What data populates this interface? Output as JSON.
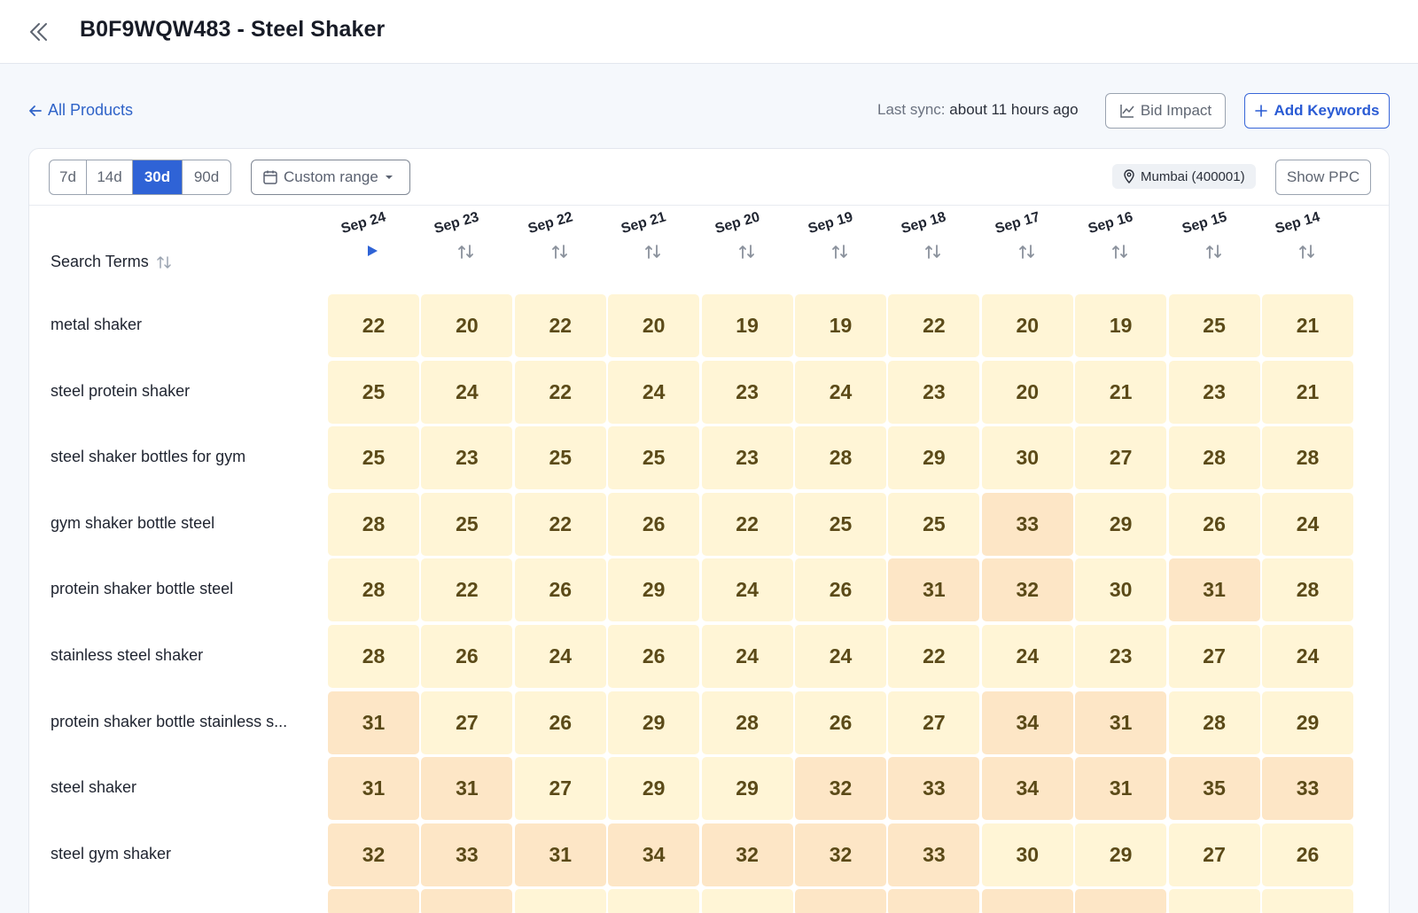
{
  "header": {
    "title": "B0F9WQW483 - Steel Shaker"
  },
  "nav": {
    "all_products": "All Products"
  },
  "sync": {
    "label": "Last sync:",
    "value": "about 11 hours ago"
  },
  "actions": {
    "bid_impact": "Bid Impact",
    "add_keywords": "Add Keywords"
  },
  "ranges": [
    {
      "label": "7d",
      "active": false
    },
    {
      "label": "14d",
      "active": false
    },
    {
      "label": "30d",
      "active": true
    },
    {
      "label": "90d",
      "active": false
    }
  ],
  "custom_range": "Custom range",
  "location": "Mumbai (400001)",
  "show_ppc": "Show PPC",
  "table": {
    "term_header": "Search Terms",
    "dates": [
      "Sep 24",
      "Sep 23",
      "Sep 22",
      "Sep 21",
      "Sep 20",
      "Sep 19",
      "Sep 18",
      "Sep 17",
      "Sep 16",
      "Sep 15",
      "Sep 14"
    ],
    "active_sort_index": 0,
    "rows": [
      {
        "term": "metal shaker",
        "ranks": [
          22,
          20,
          22,
          20,
          19,
          19,
          22,
          20,
          19,
          25,
          21
        ]
      },
      {
        "term": "steel protein shaker",
        "ranks": [
          25,
          24,
          22,
          24,
          23,
          24,
          23,
          20,
          21,
          23,
          21
        ]
      },
      {
        "term": "steel shaker bottles for gym",
        "ranks": [
          25,
          23,
          25,
          25,
          23,
          28,
          29,
          30,
          27,
          28,
          28
        ]
      },
      {
        "term": "gym shaker bottle steel",
        "ranks": [
          28,
          25,
          22,
          26,
          22,
          25,
          25,
          33,
          29,
          26,
          24
        ]
      },
      {
        "term": "protein shaker bottle steel",
        "ranks": [
          28,
          22,
          26,
          29,
          24,
          26,
          31,
          32,
          30,
          31,
          28
        ]
      },
      {
        "term": "stainless steel shaker",
        "ranks": [
          28,
          26,
          24,
          26,
          24,
          24,
          22,
          24,
          23,
          27,
          24
        ]
      },
      {
        "term": "protein shaker bottle stainless s...",
        "ranks": [
          31,
          27,
          26,
          29,
          28,
          26,
          27,
          34,
          31,
          28,
          29
        ]
      },
      {
        "term": "steel shaker",
        "ranks": [
          31,
          31,
          27,
          29,
          29,
          32,
          33,
          34,
          31,
          35,
          33
        ]
      },
      {
        "term": "steel gym shaker",
        "ranks": [
          32,
          33,
          31,
          34,
          32,
          32,
          33,
          30,
          29,
          27,
          26
        ]
      }
    ]
  },
  "colors": {
    "accent": "#2f63d6",
    "cell_light": "#fff5d6",
    "cell_warm": "#fde6c6",
    "rank_text": "#5b4a18"
  }
}
